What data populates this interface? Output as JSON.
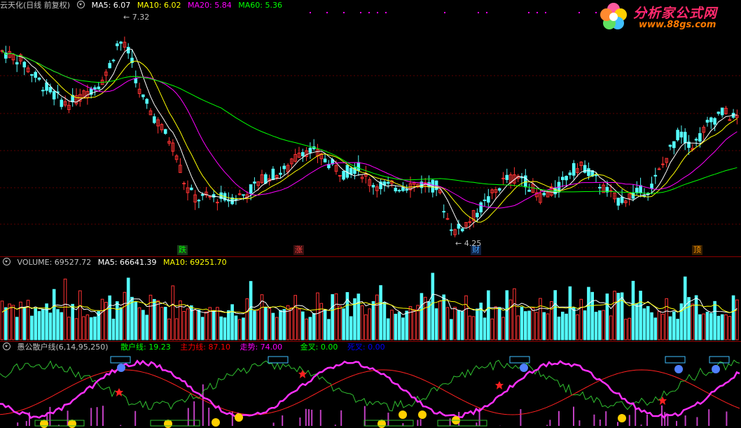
{
  "price_pane": {
    "title": "云天化(日线 前复权)",
    "indicators": [
      {
        "label": "MA5: 6.07",
        "color": "#ffffff"
      },
      {
        "label": "MA10: 6.02",
        "color": "#ffff00"
      },
      {
        "label": "MA20: 5.84",
        "color": "#ff00ff"
      },
      {
        "label": "MA60: 5.36",
        "color": "#00ff00"
      }
    ],
    "high_label": "7.32",
    "low_label": "4.25",
    "markers": [
      {
        "text": "跌",
        "color": "#00ff00",
        "bg": "#1a3a1a"
      },
      {
        "text": "涨",
        "color": "#ff4040",
        "bg": "#3a1010"
      },
      {
        "text": "财",
        "color": "#40a0ff",
        "bg": "#102040"
      },
      {
        "text": "顶",
        "color": "#ff9900",
        "bg": "#3a2000"
      }
    ]
  },
  "volume_pane": {
    "indicators": [
      {
        "label": "VOLUME: 69527.72",
        "color": "#c0c0c0"
      },
      {
        "label": "MA5: 66641.39",
        "color": "#ffffff"
      },
      {
        "label": "MA10: 69251.70",
        "color": "#ffff00"
      }
    ]
  },
  "indicator_pane": {
    "title": "愚公散户线(6,14,95,250)",
    "indicators": [
      {
        "label": "散户线: 19.23",
        "color": "#00ff00"
      },
      {
        "label": "主力线: 87.10",
        "color": "#ff0000"
      },
      {
        "label": "走势: 74.00",
        "color": "#ff00ff"
      },
      {
        "label": "金叉: 0.00",
        "color": "#00ff00"
      },
      {
        "label": "死叉: 0.00",
        "color": "#0000ff"
      }
    ]
  },
  "logo": {
    "text": "分析家公式网",
    "url_text": "www.88gs.com",
    "colors": {
      "text": "#ff2a6a",
      "url": "#ff7a00"
    }
  },
  "colors": {
    "up": "#ff3232",
    "down": "#54fcfc",
    "ma5": "#ffffff",
    "ma10": "#ffff00",
    "ma20": "#ff00ff",
    "ma60": "#00ff00"
  }
}
